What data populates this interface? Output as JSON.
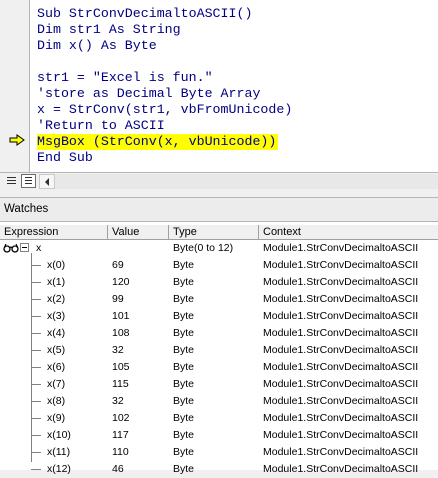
{
  "editor": {
    "lines": [
      "Sub StrConvDecimaltoASCII()",
      "Dim str1 As String",
      "Dim x() As Byte",
      "",
      "str1 = \"Excel is fun.\"",
      "'store as Decimal Byte Array",
      "x = StrConv(str1, vbFromUnicode)",
      "'Return to ASCII",
      "MsgBox (StrConv(x, vbUnicode))",
      "End Sub"
    ],
    "highlight_color": "#ffff00",
    "code_color": "#000080"
  },
  "watches": {
    "title": "Watches",
    "columns": {
      "expression": "Expression",
      "value": "Value",
      "type": "Type",
      "context": "Context"
    },
    "root": {
      "expression": "x",
      "value": "",
      "type": "Byte(0 to 12)",
      "context": "Module1.StrConvDecimaltoASCII"
    },
    "items": [
      {
        "expression": "x(0)",
        "value": "69",
        "type": "Byte",
        "context": "Module1.StrConvDecimaltoASCII"
      },
      {
        "expression": "x(1)",
        "value": "120",
        "type": "Byte",
        "context": "Module1.StrConvDecimaltoASCII"
      },
      {
        "expression": "x(2)",
        "value": "99",
        "type": "Byte",
        "context": "Module1.StrConvDecimaltoASCII"
      },
      {
        "expression": "x(3)",
        "value": "101",
        "type": "Byte",
        "context": "Module1.StrConvDecimaltoASCII"
      },
      {
        "expression": "x(4)",
        "value": "108",
        "type": "Byte",
        "context": "Module1.StrConvDecimaltoASCII"
      },
      {
        "expression": "x(5)",
        "value": "32",
        "type": "Byte",
        "context": "Module1.StrConvDecimaltoASCII"
      },
      {
        "expression": "x(6)",
        "value": "105",
        "type": "Byte",
        "context": "Module1.StrConvDecimaltoASCII"
      },
      {
        "expression": "x(7)",
        "value": "115",
        "type": "Byte",
        "context": "Module1.StrConvDecimaltoASCII"
      },
      {
        "expression": "x(8)",
        "value": "32",
        "type": "Byte",
        "context": "Module1.StrConvDecimaltoASCII"
      },
      {
        "expression": "x(9)",
        "value": "102",
        "type": "Byte",
        "context": "Module1.StrConvDecimaltoASCII"
      },
      {
        "expression": "x(10)",
        "value": "117",
        "type": "Byte",
        "context": "Module1.StrConvDecimaltoASCII"
      },
      {
        "expression": "x(11)",
        "value": "110",
        "type": "Byte",
        "context": "Module1.StrConvDecimaltoASCII"
      },
      {
        "expression": "x(12)",
        "value": "46",
        "type": "Byte",
        "context": "Module1.StrConvDecimaltoASCII"
      }
    ]
  }
}
